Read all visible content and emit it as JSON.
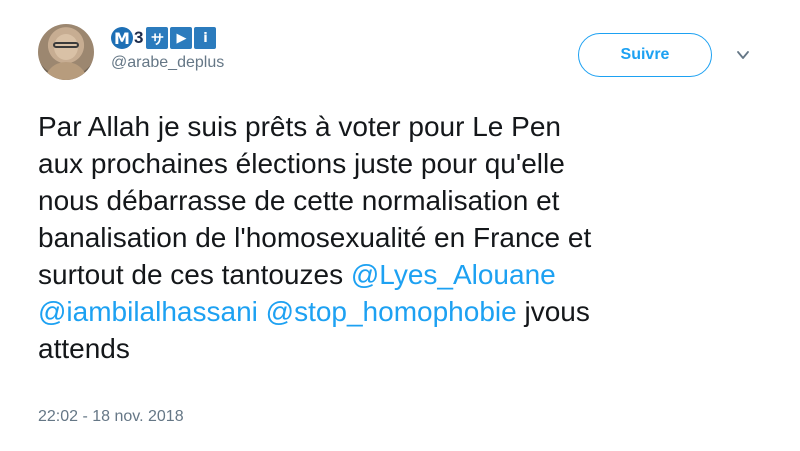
{
  "account": {
    "line_number": "3",
    "badge_icons": [
      "metro-logo-icon",
      "katakana-icon",
      "play-icon",
      "info-icon"
    ],
    "badge_glyphs": {
      "metro": "M",
      "katakana": "サ",
      "play": "▶",
      "info": "i"
    },
    "handle": "@arabe_deplus"
  },
  "follow_button": {
    "label": "Suivre"
  },
  "tweet": {
    "text_part1": "Par Allah je suis prêts à voter pour Le Pen\naux prochaines élections juste pour qu'elle\nnous débarrasse de cette normalisation et\nbanalisation de l'homosexualité en France et\nsurtout de ces tantouzes ",
    "mention1": "@Lyes_Alouane",
    "space1": "\n",
    "mention2": "@iambilalhassani",
    "space2": " ",
    "mention3": "@stop_homophobie",
    "text_part2": " jvous\nattends"
  },
  "timestamp": "22:02 - 18 nov. 2018",
  "colors": {
    "accent": "#1da1f2",
    "muted": "#657786",
    "text": "#14171a"
  }
}
